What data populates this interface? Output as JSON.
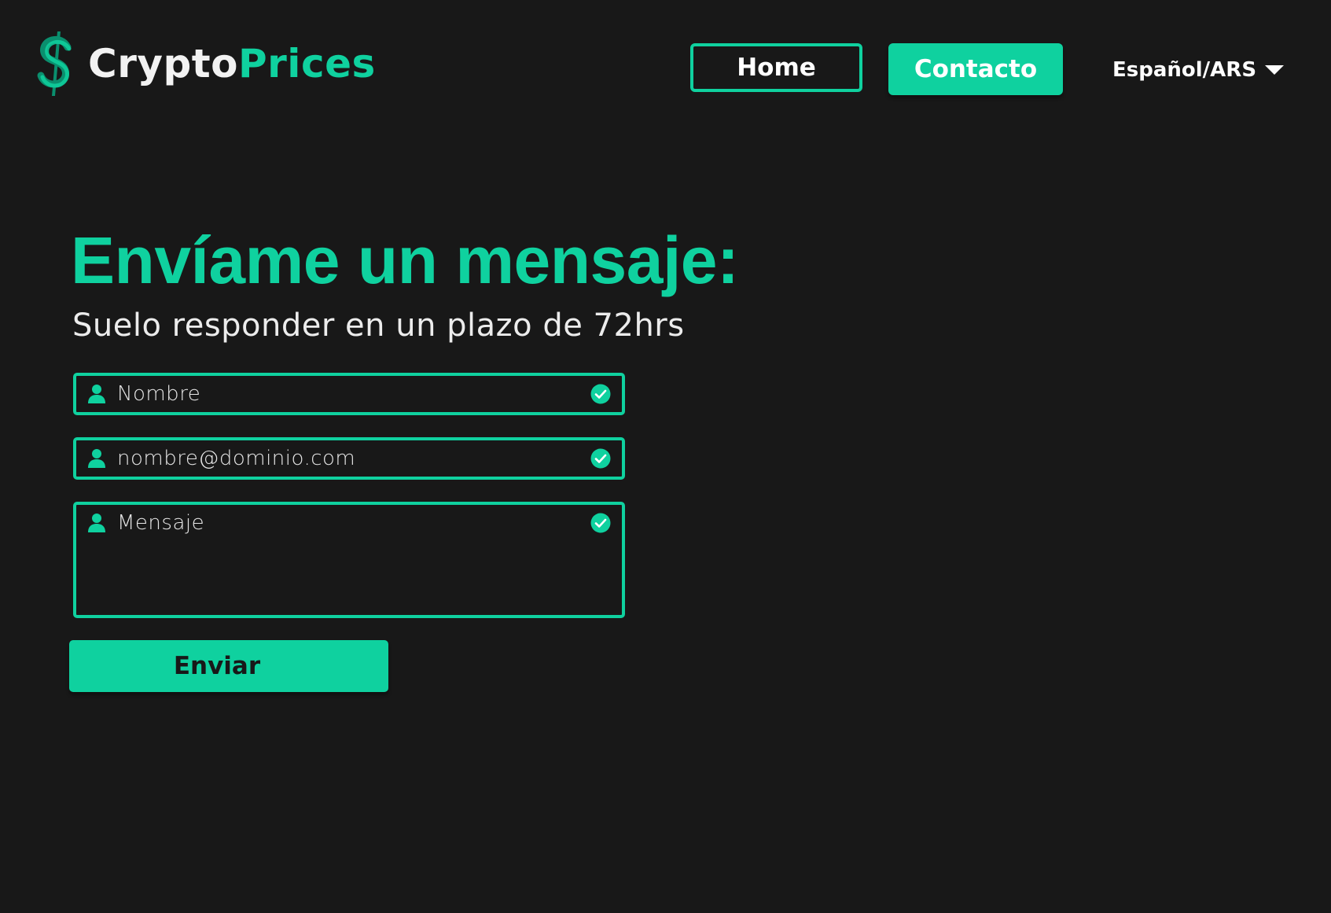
{
  "header": {
    "logo": {
      "word_white": "Crypto",
      "word_green": "Prices",
      "icon": "dollar-sign-icon"
    },
    "nav": {
      "home_label": "Home",
      "contact_label": "Contacto"
    },
    "language_selector": {
      "label": "Español/ARS",
      "icon": "caret-down-icon"
    }
  },
  "main": {
    "title": "Envíame un mensaje:",
    "subtitle": "Suelo responder en un plazo de 72hrs",
    "form": {
      "name_placeholder": "Nombre",
      "email_placeholder": "nombre@dominio.com",
      "message_placeholder": "Mensaje",
      "field_icon": "user-icon",
      "valid_icon": "check-circle-icon",
      "submit_label": "Enviar"
    }
  },
  "colors": {
    "background": "#181818",
    "accent": "#0fd19f",
    "text": "#ffffff"
  }
}
